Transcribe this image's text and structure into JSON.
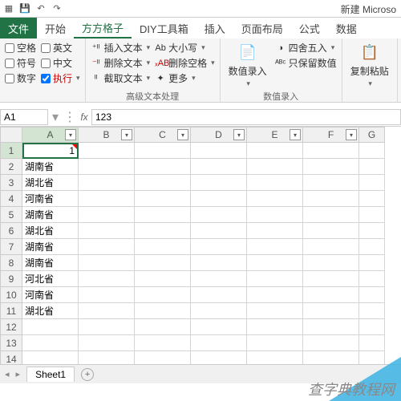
{
  "title": "新建 Microso",
  "tabs": {
    "file": "文件",
    "start": "开始",
    "ffgz": "方方格子",
    "diy": "DIY工具箱",
    "insert": "插入",
    "layout": "页面布局",
    "formula": "公式",
    "data": "数据"
  },
  "chk": {
    "space": "空格",
    "en": "英文",
    "symbol": "符号",
    "cn": "中文",
    "num": "数字",
    "exec": "执行"
  },
  "ribbon": {
    "insertText": "插入文本",
    "delText": "删除文本",
    "cutText": "截取文本",
    "case": "大小写",
    "delSpace": "删除空格",
    "more": "更多",
    "numInput": "数值录入",
    "round": "四舍五入",
    "keepNum": "只保留数值",
    "paste": "复制粘贴",
    "grpAdv": "高级文本处理",
    "grpNum": "数值录入"
  },
  "namebox": "A1",
  "fx": "fx",
  "formulaVal": "123",
  "cols": [
    "A",
    "B",
    "C",
    "D",
    "E",
    "F",
    "G"
  ],
  "rows": [
    "1",
    "2",
    "3",
    "4",
    "5",
    "6",
    "7",
    "8",
    "9",
    "10",
    "11",
    "12",
    "13",
    "14"
  ],
  "a1": "1",
  "dataA": [
    "湖南省",
    "湖北省",
    "河南省",
    "湖南省",
    "湖北省",
    "湖南省",
    "湖南省",
    "河北省",
    "河南省",
    "湖北省"
  ],
  "sheet": "Sheet1",
  "watermark": "查字典教程网",
  "chart_data": null
}
